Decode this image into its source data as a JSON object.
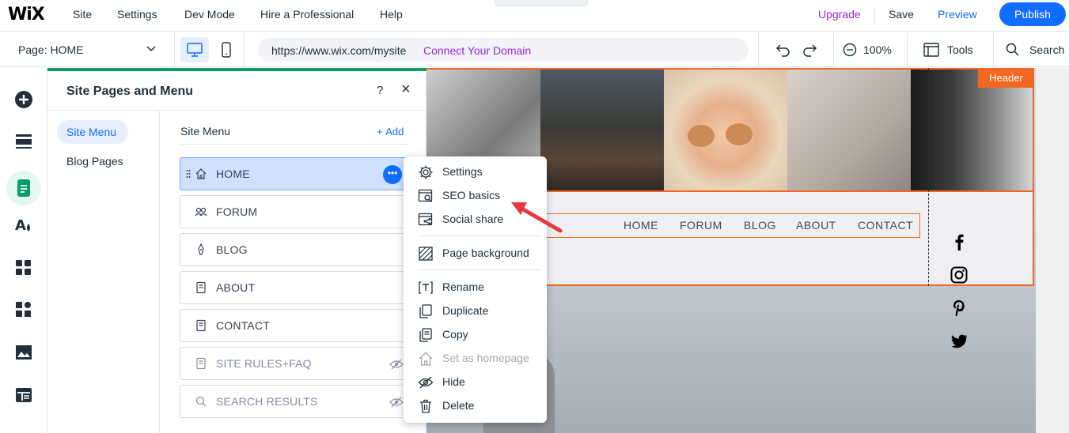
{
  "topbar": {
    "logo": "WiX",
    "menu": [
      "Site",
      "Settings",
      "Dev Mode",
      "Hire a Professional",
      "Help"
    ],
    "upgrade": "Upgrade",
    "save": "Save",
    "preview": "Preview",
    "publish": "Publish",
    "colors": {
      "upgrade": "#9a27d5",
      "preview": "#116dff",
      "publish_bg": "#116dff"
    }
  },
  "toolbar": {
    "page_select": "Page: HOME",
    "url": "https://www.wix.com/mysite",
    "connect_domain": "Connect Your Domain",
    "zoom": "100%",
    "tools": "Tools",
    "search": "Search",
    "device": "desktop"
  },
  "rail": {
    "icons": [
      "add-icon",
      "sections-icon",
      "pages-icon",
      "theme-icon",
      "apps-icon",
      "business-icon",
      "media-icon",
      "cms-icon"
    ],
    "active": "pages-icon"
  },
  "panel": {
    "title": "Site Pages and Menu",
    "help": "?",
    "close": "×",
    "left_items": [
      "Site Menu",
      "Blog Pages"
    ],
    "active_left": "Site Menu",
    "section_title": "Site Menu",
    "add": "Add",
    "pages": [
      {
        "label": "HOME",
        "icon": "home-icon",
        "selected": true,
        "hidden": false
      },
      {
        "label": "FORUM",
        "icon": "forum-icon",
        "selected": false,
        "hidden": false
      },
      {
        "label": "BLOG",
        "icon": "blog-pen-icon",
        "selected": false,
        "hidden": false
      },
      {
        "label": "ABOUT",
        "icon": "page-icon",
        "selected": false,
        "hidden": false
      },
      {
        "label": "CONTACT",
        "icon": "page-icon",
        "selected": false,
        "hidden": false
      },
      {
        "label": "SITE RULES+FAQ",
        "icon": "page-icon",
        "selected": false,
        "hidden": true
      },
      {
        "label": "SEARCH RESULTS",
        "icon": "search-icon",
        "selected": false,
        "hidden": true
      }
    ]
  },
  "context_menu": {
    "items": [
      {
        "label": "Settings",
        "icon": "gear-icon",
        "disabled": false
      },
      {
        "label": "SEO basics",
        "icon": "seo-icon",
        "disabled": false
      },
      {
        "label": "Social share",
        "icon": "social-share-icon",
        "disabled": false
      },
      {
        "label": "Page background",
        "icon": "background-icon",
        "disabled": false
      },
      {
        "label": "Rename",
        "icon": "rename-icon",
        "disabled": false
      },
      {
        "label": "Duplicate",
        "icon": "duplicate-icon",
        "disabled": false
      },
      {
        "label": "Copy",
        "icon": "copy-icon",
        "disabled": false
      },
      {
        "label": "Set as homepage",
        "icon": "home-icon",
        "disabled": true
      },
      {
        "label": "Hide",
        "icon": "hide-icon",
        "disabled": false
      },
      {
        "label": "Delete",
        "icon": "trash-icon",
        "disabled": false
      }
    ]
  },
  "canvas": {
    "header_badge": "Header",
    "site_nav": [
      "HOME",
      "FORUM",
      "BLOG",
      "ABOUT",
      "CONTACT"
    ],
    "social_icons": [
      "facebook-icon",
      "instagram-icon",
      "pinterest-icon",
      "twitter-icon"
    ],
    "accent_color": "#f26722",
    "annotation_arrow_color": "#e8383d"
  }
}
